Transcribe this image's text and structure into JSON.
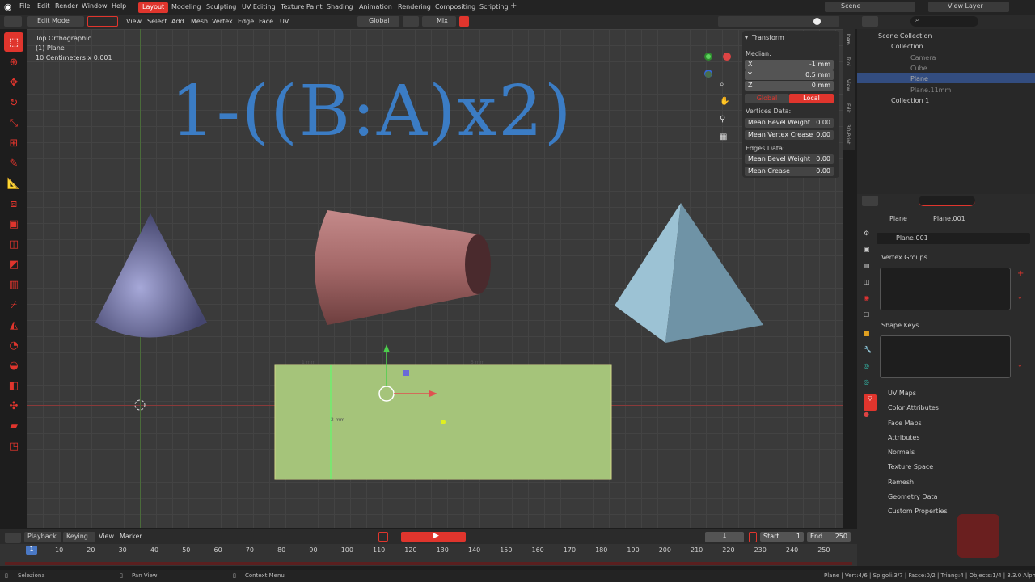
{
  "topbar": {
    "menus": [
      "File",
      "Edit",
      "Render",
      "Window",
      "Help"
    ],
    "workspaces": [
      "Layout",
      "Modeling",
      "Sculpting",
      "UV Editing",
      "Texture Paint",
      "Shading",
      "Animation",
      "Rendering",
      "Compositing",
      "Scripting"
    ],
    "scene": "Scene",
    "view_layer": "View Layer"
  },
  "header": {
    "mode": "Edit Mode",
    "menus": [
      "View",
      "Select",
      "Add",
      "Mesh",
      "Vertex",
      "Edge",
      "Face",
      "UV"
    ],
    "orientation": "Global",
    "mix": "Mix"
  },
  "viewport": {
    "view_name": "Top Orthographic",
    "object": "(1) Plane",
    "scale": "10 Centimeters x 0.001",
    "overlay_text": "1-((B:A)x2)",
    "dim_top_left": "1 mm",
    "dim_top_right": "5 mm",
    "dim_vertical": "2 mm"
  },
  "npanel": {
    "title": "Transform",
    "median": "Median:",
    "x_label": "X",
    "x_value": "-1 mm",
    "y_label": "Y",
    "y_value": "0.5 mm",
    "z_label": "Z",
    "z_value": "0 mm",
    "global": "Global",
    "local": "Local",
    "vertices_data": "Vertices Data:",
    "mean_bevel_weight": "Mean Bevel Weight",
    "mbw_value": "0.00",
    "mean_vertex_crease": "Mean Vertex Crease",
    "mvc_value": "0.00",
    "edges_data": "Edges Data:",
    "edge_bevel": "Mean Bevel Weight",
    "eb_value": "0.00",
    "mean_crease": "Mean Crease",
    "mc_value": "0.00",
    "tabs": [
      "Item",
      "Tool",
      "View",
      "Edit",
      "3D-Print"
    ]
  },
  "outliner": {
    "items": [
      "Scene Collection",
      "Collection",
      "Camera",
      "Cube",
      "Plane",
      "Plane.11mm",
      "Collection 1"
    ]
  },
  "properties": {
    "breadcrumb_obj": "Plane",
    "breadcrumb_mesh": "Plane.001",
    "mesh_name": "Plane.001",
    "sections": [
      "Vertex Groups",
      "Shape Keys",
      "UV Maps",
      "Color Attributes",
      "Face Maps",
      "Attributes",
      "Normals",
      "Texture Space",
      "Remesh",
      "Geometry Data",
      "Custom Properties"
    ]
  },
  "timeline": {
    "menus": [
      "Playback",
      "Keying",
      "View",
      "Marker"
    ],
    "current_frame": "1",
    "start_label": "Start",
    "start": "1",
    "end_label": "End",
    "end": "250",
    "ticks": [
      "10",
      "20",
      "30",
      "40",
      "50",
      "60",
      "70",
      "80",
      "90",
      "100",
      "110",
      "120",
      "130",
      "140",
      "150",
      "160",
      "170",
      "180",
      "190",
      "200",
      "210",
      "220",
      "230",
      "240",
      "250"
    ],
    "playhead": "1"
  },
  "status": {
    "select": "Seleziona",
    "pan": "Pan View",
    "context": "Context Menu",
    "stats": "Plane | Vert:4/6 | Spigoli:3/7 | Facce:0/2 | Triang:4 | Objects:1/4 | 3.3.0 Alpha"
  },
  "colors": {
    "accent": "#e0352d",
    "formula": "#3b7cc4",
    "plane": "#a5c47a",
    "cone": "#6b6c9c",
    "pyramid": "#7ea5b8",
    "frustum": "#9a6060"
  }
}
